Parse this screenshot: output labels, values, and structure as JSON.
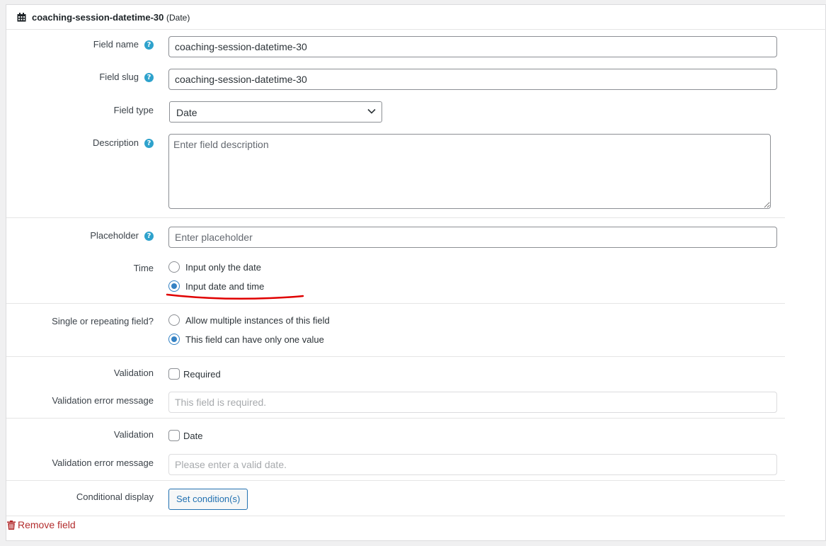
{
  "header": {
    "title": "coaching-session-datetime-30",
    "type_suffix": "(Date)",
    "icon": "calendar-icon"
  },
  "fields": {
    "field_name": {
      "label": "Field name",
      "value": "coaching-session-datetime-30"
    },
    "field_slug": {
      "label": "Field slug",
      "value": "coaching-session-datetime-30"
    },
    "field_type": {
      "label": "Field type",
      "selected": "Date"
    },
    "description": {
      "label": "Description",
      "placeholder": "Enter field description"
    },
    "placeholder": {
      "label": "Placeholder",
      "placeholder": "Enter placeholder"
    }
  },
  "time": {
    "label": "Time",
    "options": [
      "Input only the date",
      "Input date and time"
    ],
    "selected_index": 1
  },
  "repeating": {
    "label": "Single or repeating field?",
    "options": [
      "Allow multiple instances of this field",
      "This field can have only one value"
    ],
    "selected_index": 1
  },
  "validation_required": {
    "label": "Validation",
    "checkbox_label": "Required",
    "checked": false,
    "error_label": "Validation error message",
    "error_placeholder": "This field is required."
  },
  "validation_date": {
    "label": "Validation",
    "checkbox_label": "Date",
    "checked": false,
    "error_label": "Validation error message",
    "error_placeholder": "Please enter a valid date."
  },
  "conditional": {
    "label": "Conditional display",
    "button_label": "Set condition(s)"
  },
  "remove": {
    "label": "Remove field",
    "icon": "trash-icon"
  },
  "colors": {
    "accent": "#2271b1",
    "help_icon": "#2ea2cc",
    "danger": "#b32d2e",
    "annotation": "#e00000"
  }
}
